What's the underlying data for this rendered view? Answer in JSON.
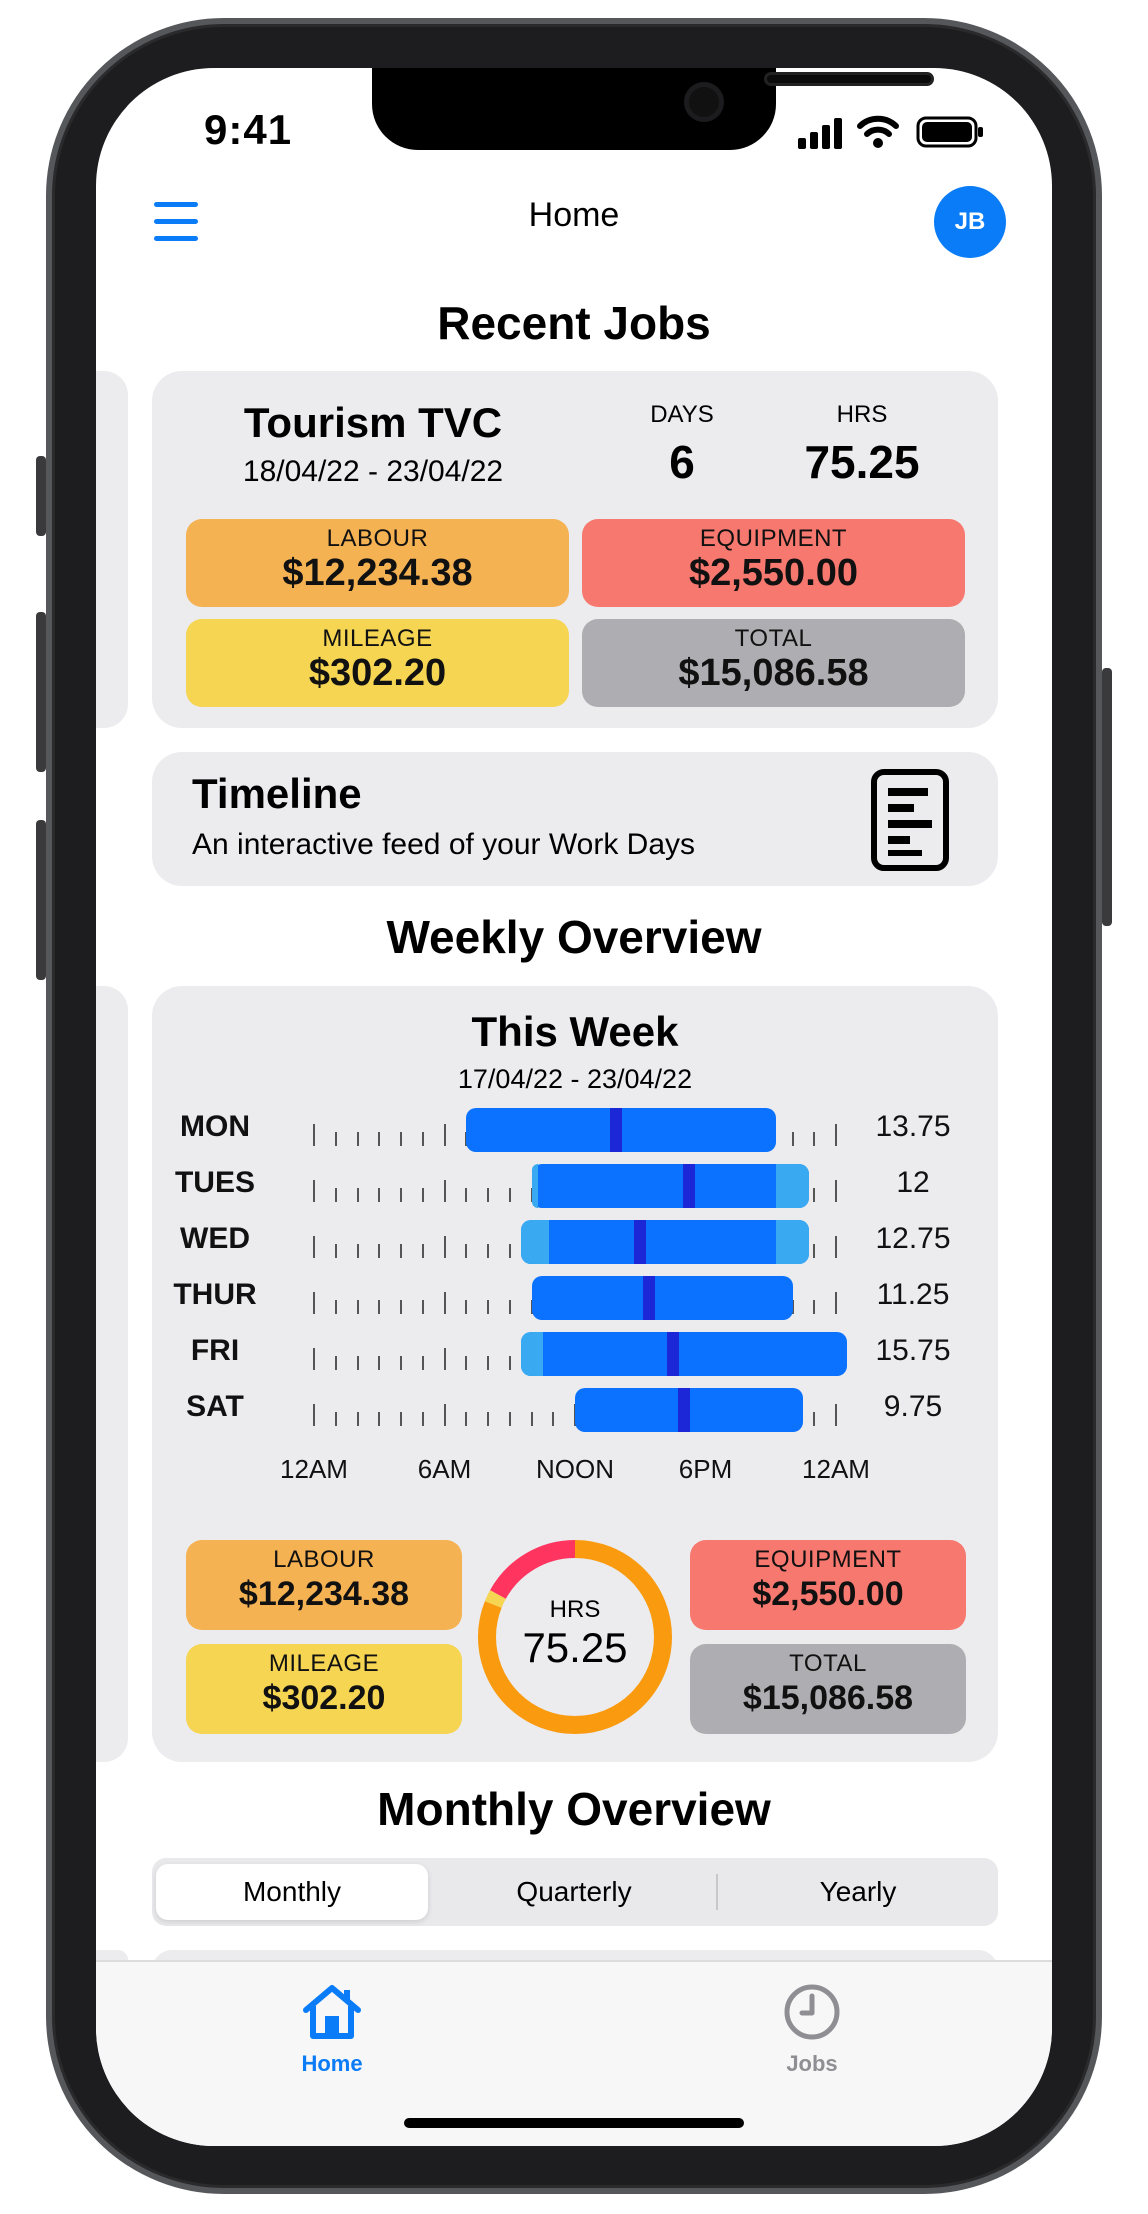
{
  "status_bar": {
    "time": "9:41"
  },
  "nav": {
    "title": "Home",
    "avatar_initials": "JB",
    "menu_icon": "hamburger-menu-icon"
  },
  "recent_jobs": {
    "heading": "Recent Jobs",
    "job": {
      "title": "Tourism TVC",
      "dates": "18/04/22 - 23/04/22",
      "days_label": "DAYS",
      "days_value": "6",
      "hrs_label": "HRS",
      "hrs_value": "75.25",
      "labour_label": "LABOUR",
      "labour_value": "$12,234.38",
      "equipment_label": "EQUIPMENT",
      "equipment_value": "$2,550.00",
      "mileage_label": "MILEAGE",
      "mileage_value": "$302.20",
      "total_label": "TOTAL",
      "total_value": "$15,086.58"
    }
  },
  "timeline": {
    "title": "Timeline",
    "subtitle": "An interactive feed of your Work Days",
    "icon": "timeline-document-icon"
  },
  "weekly": {
    "heading": "Weekly Overview",
    "card_title": "This Week",
    "dates": "17/04/22 - 23/04/22",
    "axis_labels": [
      "12AM",
      "6AM",
      "NOON",
      "6PM",
      "12AM"
    ],
    "days": [
      {
        "label": "MON",
        "hours": "13.75",
        "start": 7.0,
        "end": 21.25,
        "light_start": null,
        "light_end": null,
        "marker": 13.9
      },
      {
        "label": "TUES",
        "hours": "12",
        "start": 10.0,
        "end": 22.75,
        "light_start": 10.0,
        "light_end": 21.25,
        "marker": 17.25
      },
      {
        "label": "WED",
        "hours": "12.75",
        "start": 9.5,
        "end": 22.75,
        "light_start": 10.5,
        "light_end": 21.25,
        "marker": 15.0
      },
      {
        "label": "THUR",
        "hours": "11.25",
        "start": 10.0,
        "end": 22.0,
        "light_start": null,
        "light_end": null,
        "marker": 15.4
      },
      {
        "label": "FRI",
        "hours": "15.75",
        "start": 9.5,
        "end": 25.0,
        "light_start": 10.25,
        "light_end": null,
        "marker": 16.5
      },
      {
        "label": "SAT",
        "hours": "9.75",
        "start": 12.0,
        "end": 22.5,
        "light_start": null,
        "light_end": null,
        "marker": 17.0
      }
    ],
    "labour_label": "LABOUR",
    "labour_value": "$12,234.38",
    "equipment_label": "EQUIPMENT",
    "equipment_value": "$2,550.00",
    "mileage_label": "MILEAGE",
    "mileage_value": "$302.20",
    "total_label": "TOTAL",
    "total_value": "$15,086.58",
    "ring_label": "HRS",
    "ring_value": "75.25",
    "ring_segments": [
      {
        "name": "labour",
        "fraction": 0.81,
        "color": "#fa9b0f"
      },
      {
        "name": "mileage",
        "fraction": 0.02,
        "color": "#f5d552"
      },
      {
        "name": "equipment",
        "fraction": 0.17,
        "color": "#ff3560"
      }
    ]
  },
  "monthly": {
    "heading": "Monthly Overview",
    "segments": [
      "Monthly",
      "Quarterly",
      "Yearly"
    ],
    "selected": "Monthly"
  },
  "tabbar": {
    "tabs": [
      {
        "label": "Home",
        "icon": "house-icon",
        "active": true
      },
      {
        "label": "Jobs",
        "icon": "clock-icon",
        "active": false
      }
    ]
  },
  "colors": {
    "accent": "#0a7cf7",
    "labour": "#f5b253",
    "equipment": "#f7786f",
    "mileage": "#f5d552",
    "total": "#aeaeb2",
    "bar": "#0a72ff",
    "bar_light": "#39aaf2",
    "bar_marker": "#1c28d8"
  }
}
